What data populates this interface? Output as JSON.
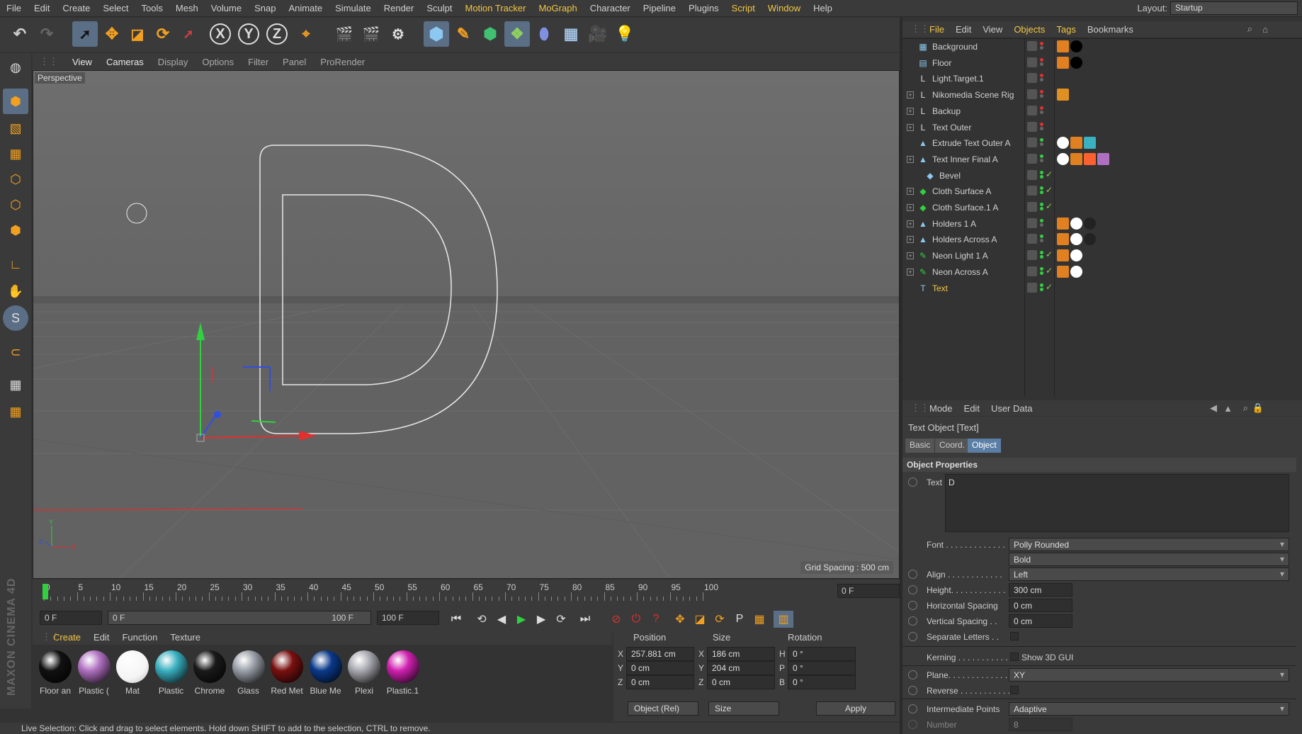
{
  "menubar": {
    "items": [
      {
        "label": "File",
        "hl": false
      },
      {
        "label": "Edit",
        "hl": false
      },
      {
        "label": "Create",
        "hl": false
      },
      {
        "label": "Select",
        "hl": false
      },
      {
        "label": "Tools",
        "hl": false
      },
      {
        "label": "Mesh",
        "hl": false
      },
      {
        "label": "Volume",
        "hl": false
      },
      {
        "label": "Snap",
        "hl": false
      },
      {
        "label": "Animate",
        "hl": false
      },
      {
        "label": "Simulate",
        "hl": false
      },
      {
        "label": "Render",
        "hl": false
      },
      {
        "label": "Sculpt",
        "hl": false
      },
      {
        "label": "Motion Tracker",
        "hl": true
      },
      {
        "label": "MoGraph",
        "hl": true
      },
      {
        "label": "Character",
        "hl": false
      },
      {
        "label": "Pipeline",
        "hl": false
      },
      {
        "label": "Plugins",
        "hl": false
      },
      {
        "label": "Script",
        "hl": true
      },
      {
        "label": "Window",
        "hl": true
      },
      {
        "label": "Help",
        "hl": false
      }
    ],
    "layout_label": "Layout:",
    "layout_value": "Startup"
  },
  "toolbar": {
    "axis_x": "X",
    "axis_y": "Y",
    "axis_z": "Z"
  },
  "viewport": {
    "menu": [
      "View",
      "Cameras",
      "Display",
      "Options",
      "Filter",
      "Panel",
      "ProRender"
    ],
    "camera": "Perspective",
    "grid_spacing": "Grid Spacing : 500 cm"
  },
  "timeline": {
    "ticks": [
      "0",
      "5",
      "10",
      "15",
      "20",
      "25",
      "30",
      "35",
      "40",
      "45",
      "50",
      "55",
      "60",
      "65",
      "70",
      "75",
      "80",
      "85",
      "90",
      "95",
      "100"
    ],
    "current_frame": "0 F",
    "start_field": "0 F",
    "range_start": "0 F",
    "range_end": "100 F",
    "end_field": "100 F"
  },
  "materials": {
    "menu": [
      {
        "label": "Create",
        "active": true
      },
      {
        "label": "Edit",
        "active": false
      },
      {
        "label": "Function",
        "active": false
      },
      {
        "label": "Texture",
        "active": false
      }
    ],
    "items": [
      {
        "label": "Floor an",
        "color": "#111111"
      },
      {
        "label": "Plastic (",
        "color": "#b070c0"
      },
      {
        "label": "Mat",
        "color": "#ffffff"
      },
      {
        "label": "Plastic",
        "color": "#3ab0c0"
      },
      {
        "label": "Chrome",
        "color": "#1a1a1a"
      },
      {
        "label": "Glass",
        "color": "#9aa0a8"
      },
      {
        "label": "Red Met",
        "color": "#7a1010"
      },
      {
        "label": "Blue Me",
        "color": "#0a3a8a"
      },
      {
        "label": "Plexi",
        "color": "#a8a8b0"
      },
      {
        "label": "Plastic.1",
        "color": "#d020b0"
      }
    ]
  },
  "coord": {
    "headers": {
      "position": "Position",
      "size": "Size",
      "rotation": "Rotation"
    },
    "rows": [
      {
        "axis": "X",
        "pos": "257.881 cm",
        "saxis": "X",
        "size": "186 cm",
        "raxis": "H",
        "rot": "0 °"
      },
      {
        "axis": "Y",
        "pos": "0 cm",
        "saxis": "Y",
        "size": "204 cm",
        "raxis": "P",
        "rot": "0 °"
      },
      {
        "axis": "Z",
        "pos": "0 cm",
        "saxis": "Z",
        "size": "0 cm",
        "raxis": "B",
        "rot": "0 °"
      }
    ],
    "mode": "Object (Rel)",
    "size_mode": "Size",
    "apply": "Apply"
  },
  "status": "Live Selection: Click and drag to select elements. Hold down SHIFT to add to the selection, CTRL to remove.",
  "object_manager": {
    "menu": [
      {
        "label": "File",
        "active": true
      },
      {
        "label": "Edit",
        "active": false
      },
      {
        "label": "View",
        "active": false
      },
      {
        "label": "Objects",
        "active": true
      },
      {
        "label": "Tags",
        "active": true
      },
      {
        "label": "Bookmarks",
        "active": false
      }
    ],
    "objects": [
      {
        "name": "Background",
        "icon": "background-icon",
        "glyph": "▦",
        "exp": false,
        "indent": 0,
        "check": false,
        "sel": false,
        "tags": [
          "#e08020",
          "#000000"
        ]
      },
      {
        "name": "Floor",
        "icon": "floor-icon",
        "glyph": "▤",
        "exp": false,
        "indent": 0,
        "check": false,
        "sel": false,
        "tags": [
          "#e08020",
          "#000000"
        ]
      },
      {
        "name": "Light.Target.1",
        "icon": "null-icon",
        "glyph": "L",
        "exp": false,
        "indent": 0,
        "check": false,
        "sel": false,
        "tags": []
      },
      {
        "name": "Nikomedia Scene Rig",
        "icon": "null-icon",
        "glyph": "L",
        "exp": true,
        "indent": 0,
        "check": false,
        "sel": false,
        "tags": [
          "#e09020"
        ]
      },
      {
        "name": "Backup",
        "icon": "null-icon",
        "glyph": "L",
        "exp": true,
        "indent": 0,
        "check": false,
        "sel": false,
        "tags": []
      },
      {
        "name": "Text Outer",
        "icon": "null-icon",
        "glyph": "L",
        "exp": true,
        "indent": 0,
        "check": false,
        "sel": false,
        "tags": []
      },
      {
        "name": "Extrude Text Outer A",
        "icon": "extrude-icon",
        "glyph": "▲",
        "exp": false,
        "indent": 0,
        "check": false,
        "sel": false,
        "tags": [
          "#ffffff",
          "#e08020",
          "#3ab0c0"
        ]
      },
      {
        "name": "Text Inner Final A",
        "icon": "extrude-icon",
        "glyph": "▲",
        "exp": true,
        "indent": 0,
        "check": false,
        "sel": false,
        "tags": [
          "#ffffff",
          "#e08020",
          "#ff6030",
          "#b070c0"
        ]
      },
      {
        "name": "Bevel",
        "icon": "bevel-icon",
        "glyph": "◆",
        "exp": false,
        "indent": 1,
        "check": true,
        "sel": false,
        "tags": []
      },
      {
        "name": "Cloth Surface A",
        "icon": "cloth-icon",
        "glyph": "◆",
        "exp": true,
        "indent": 0,
        "check": true,
        "sel": false,
        "tags": []
      },
      {
        "name": "Cloth Surface.1 A",
        "icon": "cloth-icon",
        "glyph": "◆",
        "exp": true,
        "indent": 0,
        "check": true,
        "sel": false,
        "tags": []
      },
      {
        "name": "Holders 1 A",
        "icon": "extrude-icon",
        "glyph": "▲",
        "exp": true,
        "indent": 0,
        "check": false,
        "sel": false,
        "tags": [
          "#e08020",
          "#ffffff",
          "#222222"
        ]
      },
      {
        "name": "Holders Across A",
        "icon": "extrude-icon",
        "glyph": "▲",
        "exp": true,
        "indent": 0,
        "check": false,
        "sel": false,
        "tags": [
          "#e08020",
          "#ffffff",
          "#222222"
        ]
      },
      {
        "name": "Neon Light 1 A",
        "icon": "sweep-icon",
        "glyph": "✎",
        "exp": true,
        "indent": 0,
        "check": true,
        "sel": false,
        "tags": [
          "#e08020",
          "#ffffff"
        ]
      },
      {
        "name": "Neon Across A",
        "icon": "sweep-icon",
        "glyph": "✎",
        "exp": true,
        "indent": 0,
        "check": true,
        "sel": false,
        "tags": [
          "#e08020",
          "#ffffff"
        ]
      },
      {
        "name": "Text",
        "icon": "text-icon",
        "glyph": "T",
        "exp": false,
        "indent": 0,
        "check": true,
        "sel": true,
        "tags": []
      }
    ]
  },
  "attributes": {
    "menu": [
      "Mode",
      "Edit",
      "User Data"
    ],
    "title": "Text Object [Text]",
    "tabs": [
      {
        "label": "Basic",
        "active": false
      },
      {
        "label": "Coord.",
        "active": false
      },
      {
        "label": "Object",
        "active": true
      }
    ],
    "section": "Object Properties",
    "text_label": "Text",
    "text_value": "D",
    "font_label": "Font . . . . . . . . . . . . .",
    "font_value": "Polly Rounded",
    "font_style": "Bold",
    "align_label": "Align . . . . . . . . . . . .",
    "align_value": "Left",
    "height_label": "Height. . . . . . . . . . . .",
    "height_value": "300 cm",
    "hspacing_label": "Horizontal Spacing",
    "hspacing_value": "0 cm",
    "vspacing_label": "Vertical Spacing . .",
    "vspacing_value": "0 cm",
    "separate_label": "Separate Letters . .",
    "kerning_label": "Kerning . . . . . . . . . . .",
    "show3d_label": "Show 3D GUI",
    "plane_label": "Plane. . . . . . . . . . . . .",
    "plane_value": "XY",
    "reverse_label": "Reverse . . . . . . . . . . .",
    "intermediate_label": "Intermediate Points",
    "intermediate_value": "Adaptive",
    "number_label": "Number",
    "number_value": "8"
  }
}
